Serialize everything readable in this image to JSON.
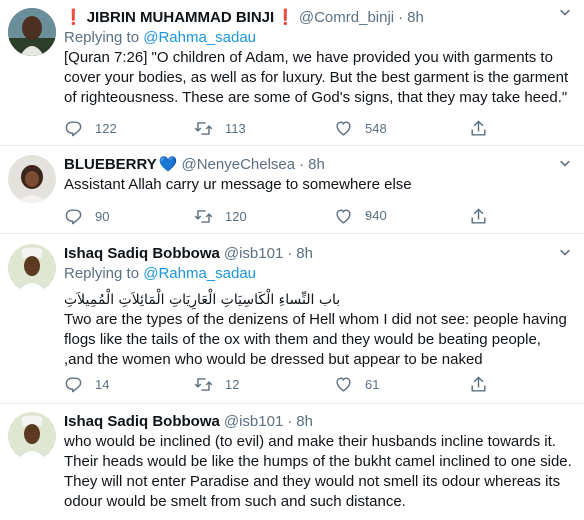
{
  "tweets": [
    {
      "display_name": "JIBRIN MUHAMMAD BINJI",
      "name_prefix_emoji": "❗",
      "name_suffix_emoji": "❗",
      "handle": "@Comrd_binji",
      "dot": "·",
      "time": "8h",
      "replying_to_label": "Replying to",
      "replying_to_handle": "@Rahma_sadau",
      "lines": [
        "[Quran 7:26] \"O children of Adam, we have provided you with garments to",
        "cover your bodies, as well as for luxury. But the best garment is the garment",
        "of righteousness. These are some of God's signs, that they may take heed.\""
      ],
      "replies": "122",
      "retweets": "113",
      "likes": "548"
    },
    {
      "display_name": "BLUEBERRY",
      "name_suffix_emoji": "💙",
      "handle": "@NenyeChelsea",
      "dot": "·",
      "time": "8h",
      "lines": [
        "Assistant Allah carry ur message to somewhere else"
      ],
      "replies": "90",
      "retweets": "120",
      "likes": "940",
      "likes_top": "-"
    },
    {
      "display_name": "Ishaq Sadiq Bobbowa",
      "handle": "@isb101",
      "dot": "·",
      "time": "8h",
      "replying_to_label": "Replying to",
      "replying_to_handle": "@Rahma_sadau",
      "arabic_line": "باب النِّساءِ الْكَاسِيَاتِ الْعَارِيَاتِ الْمَائِلاَتِ الْمُمِيلاَتِ",
      "lines": [
        "Two are the types of the denizens of Hell whom I did not see: people having",
        "flogs like the tails of the ox with them and they would be beating people,",
        ",and the women who would be dressed but appear to be naked"
      ],
      "replies": "14",
      "retweets": "12",
      "likes": "61"
    },
    {
      "display_name": "Ishaq Sadiq Bobbowa",
      "handle": "@isb101",
      "dot": "·",
      "time": "8h",
      "lines": [
        "who would be inclined (to evil) and make their husbands incline towards it.",
        "Their heads would be like the humps of the bukht camel inclined to one side.",
        "They will not enter Paradise and they would not smell its odour whereas its",
        "odour would be smelt from such and such distance."
      ]
    }
  ],
  "colors": {
    "text": "#0f1419",
    "secondary": "#5b7083",
    "link": "#1b95e0",
    "divider": "#e6ecf0",
    "red_emoji": "#e0245e",
    "blue_heart": "#5dadec"
  }
}
